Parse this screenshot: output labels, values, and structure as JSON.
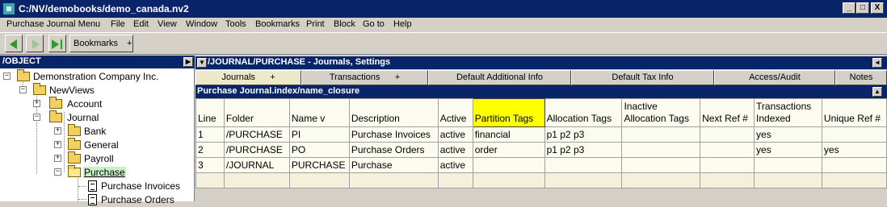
{
  "window": {
    "title": "C:/NV/demobooks/demo_canada.nv2",
    "controls": [
      "_",
      "□",
      "X"
    ]
  },
  "menu": [
    "Purchase Journal Menu",
    "File",
    "Edit",
    "View",
    "Window",
    "Tools",
    "Bookmarks",
    "Print",
    "Block",
    "Go to",
    "Help"
  ],
  "toolbar": {
    "bookmarks_label": "Bookmarks",
    "bookmarks_plus": "+"
  },
  "tree": {
    "header": "/OBJECT",
    "header_btn": "▶",
    "items": [
      {
        "label": "Demonstration Company Inc.",
        "toggle": "−"
      },
      {
        "label": "NewViews",
        "toggle": "−"
      },
      {
        "label": "Account",
        "toggle": "+"
      },
      {
        "label": "Journal",
        "toggle": "−"
      },
      {
        "label": "Bank",
        "toggle": "+"
      },
      {
        "label": "General",
        "toggle": "+"
      },
      {
        "label": "Payroll",
        "toggle": "+"
      },
      {
        "label": "Purchase",
        "toggle": "−"
      },
      {
        "label": "Purchase Invoices",
        "toggle": ""
      },
      {
        "label": "Purchase Orders",
        "toggle": ""
      }
    ]
  },
  "view": {
    "header_btn": "▼",
    "title": "/JOURNAL/PURCHASE - Journals, Settings",
    "header_right_btn": "◄",
    "tabs": [
      "Journals      +",
      "Transactions      +",
      "Default Additional Info",
      "Default Tax Info",
      "Access/Audit",
      "Notes"
    ],
    "subheader": "Purchase Journal.index/name_closure",
    "subheader_btn": "▲"
  },
  "grid": {
    "columns": [
      "Line",
      "Folder",
      "Name  v",
      "Description",
      "Active",
      "Partition Tags",
      "Allocation Tags",
      "Inactive Allocation Tags",
      "Next Ref #",
      "Transactions Indexed",
      "Unique Ref #"
    ],
    "rows": [
      [
        "1",
        "/PURCHASE",
        "PI",
        "Purchase Invoices",
        "active",
        "financial",
        "p1 p2 p3",
        "",
        "",
        "yes",
        ""
      ],
      [
        "2",
        "/PURCHASE",
        "PO",
        "Purchase Orders",
        "active",
        "order",
        "p1 p2 p3",
        "",
        "",
        "yes",
        "yes"
      ],
      [
        "3",
        "/JOURNAL",
        "PURCHASE",
        "Purchase",
        "active",
        "",
        "",
        "",
        "",
        "",
        ""
      ]
    ]
  },
  "colors": {
    "titlebar": "#0a246a",
    "highlight_column": "#ffff00",
    "cell_bg": "#fbfbf0"
  }
}
